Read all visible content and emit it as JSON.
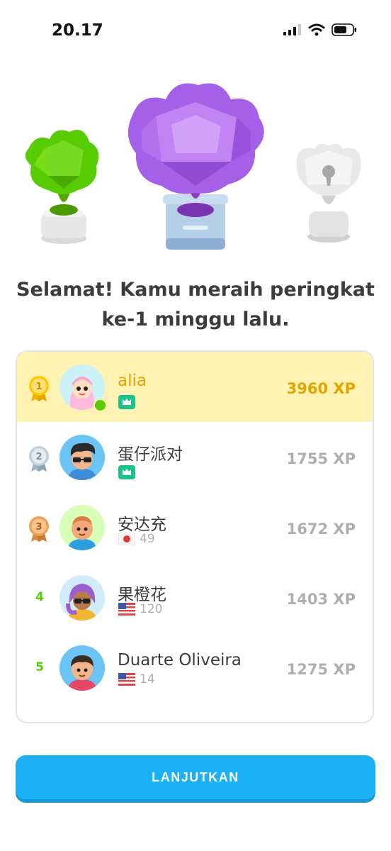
{
  "status_bar": {
    "time": "20.17"
  },
  "headline": {
    "line1": "Selamat! Kamu meraih peringkat",
    "line2": "ke-1 minggu lalu."
  },
  "leaderboard": [
    {
      "rank": "1",
      "name": "alia",
      "badge": "league-icon",
      "xp": "3960 XP",
      "highlighted": true
    },
    {
      "rank": "2",
      "name": "蛋仔派对",
      "badge": "league-icon",
      "xp": "1755 XP"
    },
    {
      "rank": "3",
      "name": "安达充",
      "flag": "japan-flag",
      "streak": "49",
      "xp": "1672 XP"
    },
    {
      "rank": "4",
      "name": "果橙花",
      "flag": "us-flag",
      "streak": "120",
      "xp": "1403 XP"
    },
    {
      "rank": "5",
      "name": "Duarte Oliveira",
      "flag": "us-flag",
      "streak": "14",
      "xp": "1275 XP"
    }
  ],
  "button": {
    "label": "LANJUTKAN"
  },
  "colors": {
    "accent_blue": "#1cb0f6",
    "highlight_bg": "#fff3b3",
    "gold_text": "#e2a400",
    "rank_green": "#58cc02",
    "muted": "#afafaf"
  }
}
